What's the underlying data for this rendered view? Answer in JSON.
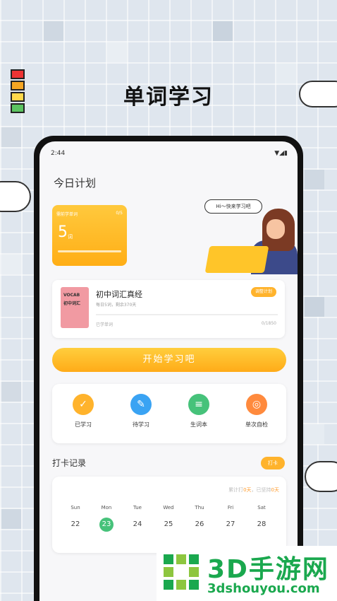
{
  "heading": "单词学习",
  "status": {
    "time": "2:44"
  },
  "today": {
    "title": "今日计划"
  },
  "plan_card": {
    "label": "需前学单词",
    "count": "0/5",
    "number": "5",
    "unit": "词"
  },
  "bubble_text": "Hi～快来学习吧",
  "book": {
    "cover_line1": "VOCAB",
    "cover_line2": "初中词汇",
    "title": "初中词汇真经",
    "sub": "每日5词，剩余370天",
    "learned": "已学单词",
    "total": "0/1850",
    "switch_label": "调整计划"
  },
  "start_button": "开始学习吧",
  "menu": [
    {
      "label": "已学习",
      "icon": "calendar-check-icon",
      "color": "#ffb32c",
      "glyph": "✓"
    },
    {
      "label": "待学习",
      "icon": "pencil-doc-icon",
      "color": "#3aa3f3",
      "glyph": "✎"
    },
    {
      "label": "生词本",
      "icon": "list-icon",
      "color": "#46c27a",
      "glyph": "≡"
    },
    {
      "label": "单次自检",
      "icon": "book-search-icon",
      "color": "#ff8a3d",
      "glyph": "◎"
    }
  ],
  "checkin": {
    "title": "打卡记录",
    "button": "打卡",
    "stats_prefix": "累计打",
    "stats_days": "0天",
    "stats_mid": "，已坚持",
    "stats_days2": "0天"
  },
  "calendar": {
    "days": [
      "Sun",
      "Mon",
      "Tue",
      "Wed",
      "Thu",
      "Fri",
      "Sat"
    ],
    "dates": [
      "22",
      "23",
      "24",
      "25",
      "26",
      "27",
      "28"
    ],
    "active_index": 1
  },
  "watermark": {
    "big": "3D手游网",
    "small": "3dshouyou.com"
  }
}
